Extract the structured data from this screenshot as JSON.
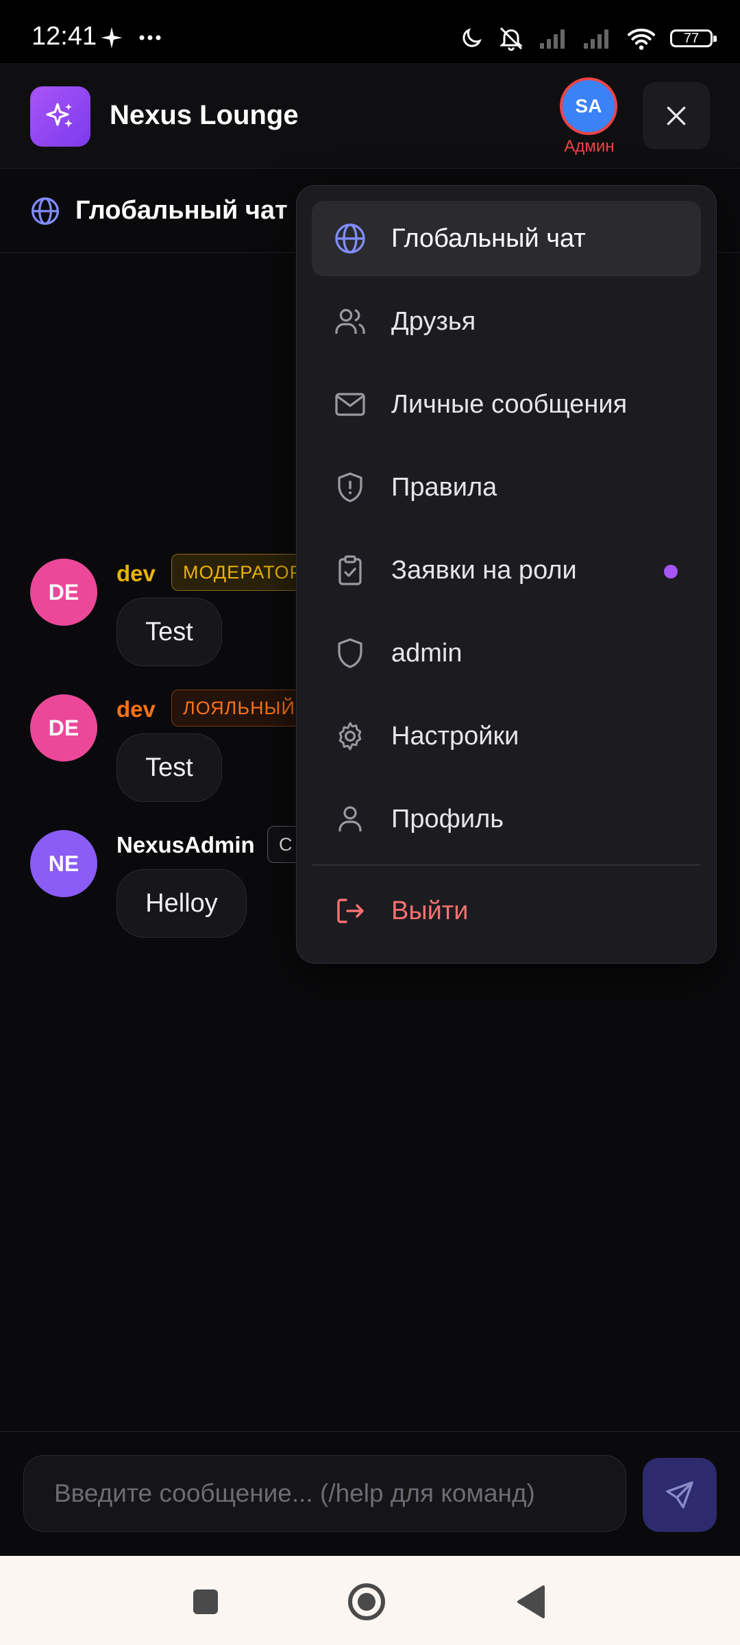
{
  "status_bar": {
    "time": "12:41",
    "battery": "77"
  },
  "header": {
    "app_title": "Nexus Lounge",
    "user_initials": "SA",
    "user_role": "Админ",
    "logo_icon": "sparkles-icon",
    "accent": "#a855f7"
  },
  "channel": {
    "title": "Глобальный чат",
    "icon": "globe-icon"
  },
  "messages": [
    {
      "initials": "DE",
      "author": "dev",
      "author_color": "#eab308",
      "badge": "МОДЕРАТОР",
      "text": "Test",
      "avatar_color": "#ec4899"
    },
    {
      "initials": "DE",
      "author": "dev",
      "author_color": "#f97316",
      "badge": "ЛОЯЛЬНЫЙ",
      "text": "Test",
      "avatar_color": "#ec4899"
    },
    {
      "initials": "NE",
      "author": "NexusAdmin",
      "author_color": "#ffffff",
      "badge": "С",
      "text": "Helloy",
      "avatar_color": "#8b5cf6"
    }
  ],
  "menu": {
    "items": [
      {
        "label": "Глобальный чат",
        "icon": "globe-icon",
        "active": true
      },
      {
        "label": "Друзья",
        "icon": "users-icon"
      },
      {
        "label": "Личные сообщения",
        "icon": "mail-icon"
      },
      {
        "label": "Правила",
        "icon": "shield-alert-icon"
      },
      {
        "label": "Заявки на роли",
        "icon": "clipboard-check-icon",
        "has_notification": true
      },
      {
        "label": "admin",
        "icon": "shield-icon"
      },
      {
        "label": "Настройки",
        "icon": "gear-icon"
      },
      {
        "label": "Профиль",
        "icon": "user-icon"
      }
    ],
    "logout": {
      "label": "Выйти",
      "icon": "logout-icon",
      "color": "#f87171"
    }
  },
  "composer": {
    "placeholder": "Введите сообщение... (/help для команд)"
  }
}
